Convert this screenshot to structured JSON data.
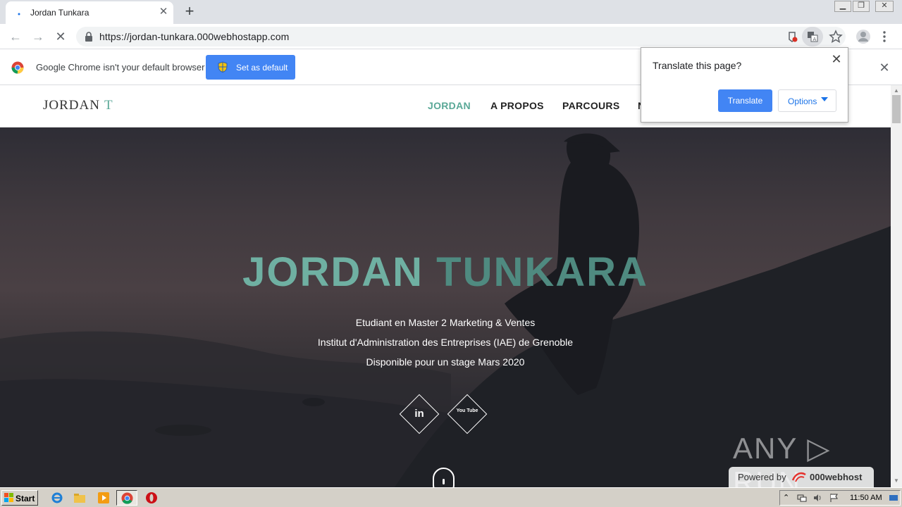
{
  "browser": {
    "tab": {
      "title": "Jordan Tunkara",
      "close": "✕"
    },
    "new_tab": "+",
    "url": "https://jordan-tunkara.000webhostapp.com",
    "infobar": {
      "message": "Google Chrome isn't your default browser",
      "button": "Set as default",
      "close": "✕"
    },
    "translate_popup": {
      "question": "Translate this page?",
      "translate_button": "Translate",
      "options_button": "Options",
      "close": "✕"
    }
  },
  "site": {
    "brand": {
      "name": "JORDAN",
      "initial": "T"
    },
    "nav": [
      {
        "label": "JORDAN",
        "active": true
      },
      {
        "label": "A PROPOS"
      },
      {
        "label": "PARCOURS"
      },
      {
        "label": "N"
      }
    ],
    "hero": {
      "title_first": "JORDAN",
      "title_last": "TUNKARA",
      "lines": [
        "Etudiant en Master 2 Marketing & Ventes",
        "Institut d'Administration des Entreprises (IAE) de Grenoble",
        "Disponible pour un stage Mars 2020"
      ],
      "social": [
        {
          "icon": "linkedin-icon",
          "text": "in"
        },
        {
          "icon": "youtube-icon",
          "text": "You Tube"
        }
      ]
    }
  },
  "watermark": {
    "anyrun": "ANY ▷ RUN",
    "powered_by": "Powered by",
    "host": "000webhost"
  },
  "taskbar": {
    "start": "Start",
    "clock": "11:50 AM"
  },
  "colors": {
    "accent": "#5aa897",
    "chrome_blue": "#4285f4"
  }
}
